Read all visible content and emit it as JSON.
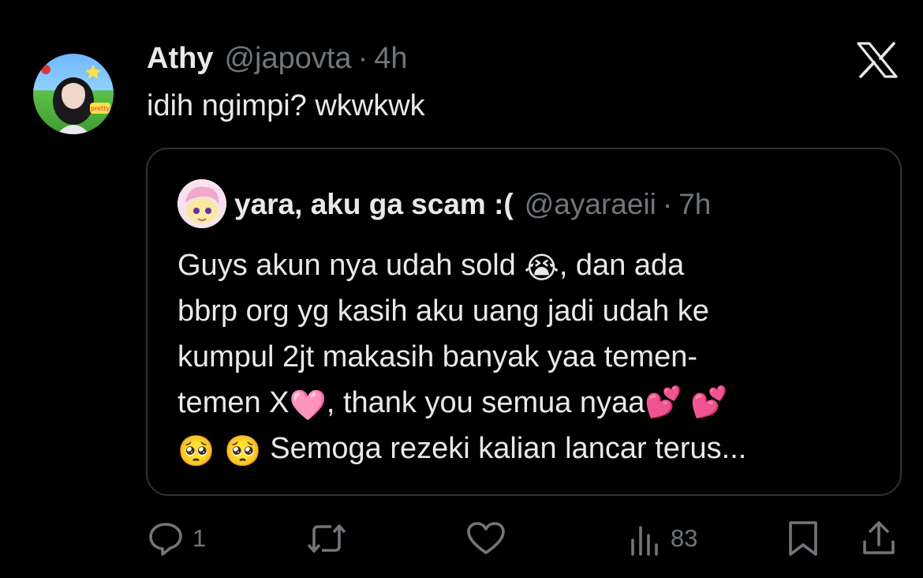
{
  "tweet": {
    "author_name": "Athy",
    "author_handle": "@japovta",
    "separator": "·",
    "time": "4h",
    "text": "idih ngimpi? wkwkwk",
    "avatar_sticker": "pretty athy"
  },
  "quoted_tweet": {
    "author_name": "yara, aku ga scam :(",
    "author_handle": "@ayaraeii",
    "separator": "·",
    "time": "7h",
    "lines": [
      {
        "before": "Guys akun nya udah sold ",
        "emoji": "😭",
        "after": ", dan ada"
      },
      {
        "before": "bbrp org yg kasih aku uang jadi udah ke",
        "emoji": "",
        "after": ""
      },
      {
        "before": "kumpul 2jt makasih banyak yaa temen-",
        "emoji": "",
        "after": ""
      },
      {
        "before": "temen X",
        "emoji": "🩷",
        "after": ", thank you semua nyaa💕 💕"
      },
      {
        "before": "",
        "emoji": "🥺 🥺",
        "after": " Semoga rezeki kalian lancar terus..."
      }
    ]
  },
  "actions": {
    "reply_icon": "reply-icon",
    "reply_count": "1",
    "retweet_icon": "retweet-icon",
    "like_icon": "heart-icon",
    "views_icon": "views-icon",
    "views_count": "83",
    "bookmark_icon": "bookmark-icon",
    "share_icon": "share-icon"
  },
  "brand": {
    "logo": "x-logo-icon",
    "text_color": "#e7e9ea",
    "muted_color": "#71767b",
    "border_color": "#2f3336",
    "background": "#000000"
  }
}
